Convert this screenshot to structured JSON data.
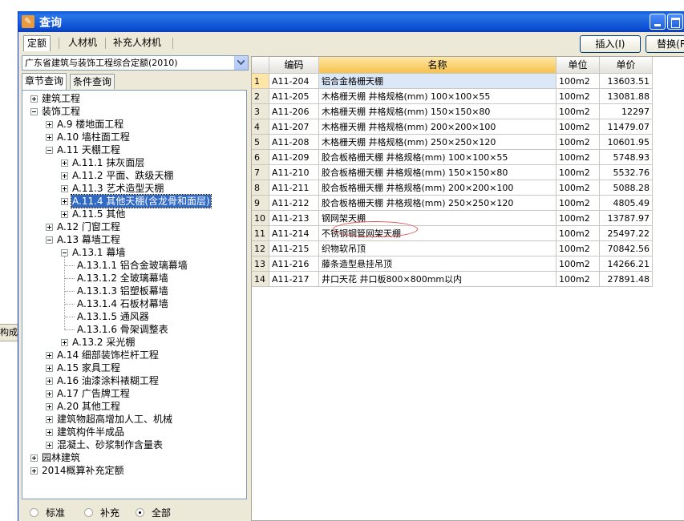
{
  "window": {
    "title": "查询"
  },
  "desktop": {
    "left_stub_text": "构成"
  },
  "top_tabs": [
    "定额",
    "人材机",
    "补充人材机"
  ],
  "buttons": {
    "insert": "插入(I)",
    "replace": "替换(R)"
  },
  "combo": {
    "value": "广东省建筑与装饰工程综合定额(2010)"
  },
  "sub_tabs": [
    "章节查询",
    "条件查询"
  ],
  "tree": [
    {
      "label": "建筑工程",
      "level": 0,
      "expander": "plus"
    },
    {
      "label": "装饰工程",
      "level": 0,
      "expander": "minus"
    },
    {
      "label": "A.9 楼地面工程",
      "level": 1,
      "expander": "plus"
    },
    {
      "label": "A.10 墙柱面工程",
      "level": 1,
      "expander": "plus"
    },
    {
      "label": "A.11 天棚工程",
      "level": 1,
      "expander": "minus"
    },
    {
      "label": "A.11.1 抹灰面层",
      "level": 2,
      "expander": "plus"
    },
    {
      "label": "A.11.2 平面、跌级天棚",
      "level": 2,
      "expander": "plus"
    },
    {
      "label": "A.11.3 艺术造型天棚",
      "level": 2,
      "expander": "plus"
    },
    {
      "label": "A.11.4 其他天棚(含龙骨和面层)",
      "level": 2,
      "expander": "plus",
      "selected": true
    },
    {
      "label": "A.11.5 其他",
      "level": 2,
      "expander": "plus"
    },
    {
      "label": "A.12 门窗工程",
      "level": 1,
      "expander": "plus"
    },
    {
      "label": "A.13 幕墙工程",
      "level": 1,
      "expander": "minus"
    },
    {
      "label": "A.13.1 幕墙",
      "level": 2,
      "expander": "minus"
    },
    {
      "label": "A.13.1.1 铝合金玻璃幕墙",
      "level": 3,
      "expander": "none"
    },
    {
      "label": "A.13.1.2 全玻璃幕墙",
      "level": 3,
      "expander": "none"
    },
    {
      "label": "A.13.1.3 铝塑板幕墙",
      "level": 3,
      "expander": "none"
    },
    {
      "label": "A.13.1.4 石板材幕墙",
      "level": 3,
      "expander": "none"
    },
    {
      "label": "A.13.1.5 通风器",
      "level": 3,
      "expander": "none"
    },
    {
      "label": "A.13.1.6 骨架调整表",
      "level": 3,
      "expander": "none"
    },
    {
      "label": "A.13.2 采光棚",
      "level": 2,
      "expander": "plus"
    },
    {
      "label": "A.14 细部装饰栏杆工程",
      "level": 1,
      "expander": "plus"
    },
    {
      "label": "A.15 家具工程",
      "level": 1,
      "expander": "plus"
    },
    {
      "label": "A.16 油漆涂料裱糊工程",
      "level": 1,
      "expander": "plus"
    },
    {
      "label": "A.17 广告牌工程",
      "level": 1,
      "expander": "plus"
    },
    {
      "label": "A.20 其他工程",
      "level": 1,
      "expander": "plus"
    },
    {
      "label": "建筑物超高增加人工、机械",
      "level": 1,
      "expander": "plus"
    },
    {
      "label": "建筑构件半成品",
      "level": 1,
      "expander": "plus"
    },
    {
      "label": "混凝土、砂浆制作含量表",
      "level": 1,
      "expander": "plus"
    },
    {
      "label": "园林建筑",
      "level": 0,
      "expander": "plus"
    },
    {
      "label": "2014概算补充定额",
      "level": 0,
      "expander": "plus"
    }
  ],
  "filter": {
    "options": [
      "标准",
      "补充",
      "全部"
    ],
    "selected": "全部"
  },
  "grid": {
    "columns": [
      "",
      "编码",
      "名称",
      "单位",
      "单价"
    ],
    "rows": [
      {
        "no": "1",
        "code": "A11-204",
        "name": "铝合金格栅天棚",
        "unit": "100m2",
        "price": "13603.51"
      },
      {
        "no": "2",
        "code": "A11-205",
        "name": "木格栅天棚 井格规格(mm) 100×100×55",
        "unit": "100m2",
        "price": "13081.88"
      },
      {
        "no": "3",
        "code": "A11-206",
        "name": "木格栅天棚 井格规格(mm) 150×150×80",
        "unit": "100m2",
        "price": "12297"
      },
      {
        "no": "4",
        "code": "A11-207",
        "name": "木格栅天棚 井格规格(mm) 200×200×100",
        "unit": "100m2",
        "price": "11479.07"
      },
      {
        "no": "5",
        "code": "A11-208",
        "name": "木格栅天棚 井格规格(mm) 250×250×120",
        "unit": "100m2",
        "price": "10601.95"
      },
      {
        "no": "6",
        "code": "A11-209",
        "name": "胶合板格栅天棚 井格规格(mm) 100×100×55",
        "unit": "100m2",
        "price": "5748.93"
      },
      {
        "no": "7",
        "code": "A11-210",
        "name": "胶合板格栅天棚 井格规格(mm) 150×150×80",
        "unit": "100m2",
        "price": "5532.76"
      },
      {
        "no": "8",
        "code": "A11-211",
        "name": "胶合板格栅天棚 井格规格(mm) 200×200×100",
        "unit": "100m2",
        "price": "5088.28"
      },
      {
        "no": "9",
        "code": "A11-212",
        "name": "胶合板格栅天棚 井格规格(mm) 250×250×120",
        "unit": "100m2",
        "price": "4805.49"
      },
      {
        "no": "10",
        "code": "A11-213",
        "name": "钢网架天棚",
        "unit": "100m2",
        "price": "13787.97"
      },
      {
        "no": "11",
        "code": "A11-214",
        "name": "不锈钢钢管网架天棚",
        "unit": "100m2",
        "price": "25497.22"
      },
      {
        "no": "12",
        "code": "A11-215",
        "name": "织物软吊顶",
        "unit": "100m2",
        "price": "70842.56"
      },
      {
        "no": "13",
        "code": "A11-216",
        "name": "藤条造型悬挂吊顶",
        "unit": "100m2",
        "price": "14266.21"
      },
      {
        "no": "14",
        "code": "A11-217",
        "name": "井口天花 井口板800×800mm以内",
        "unit": "100m2",
        "price": "27891.48"
      }
    ]
  }
}
